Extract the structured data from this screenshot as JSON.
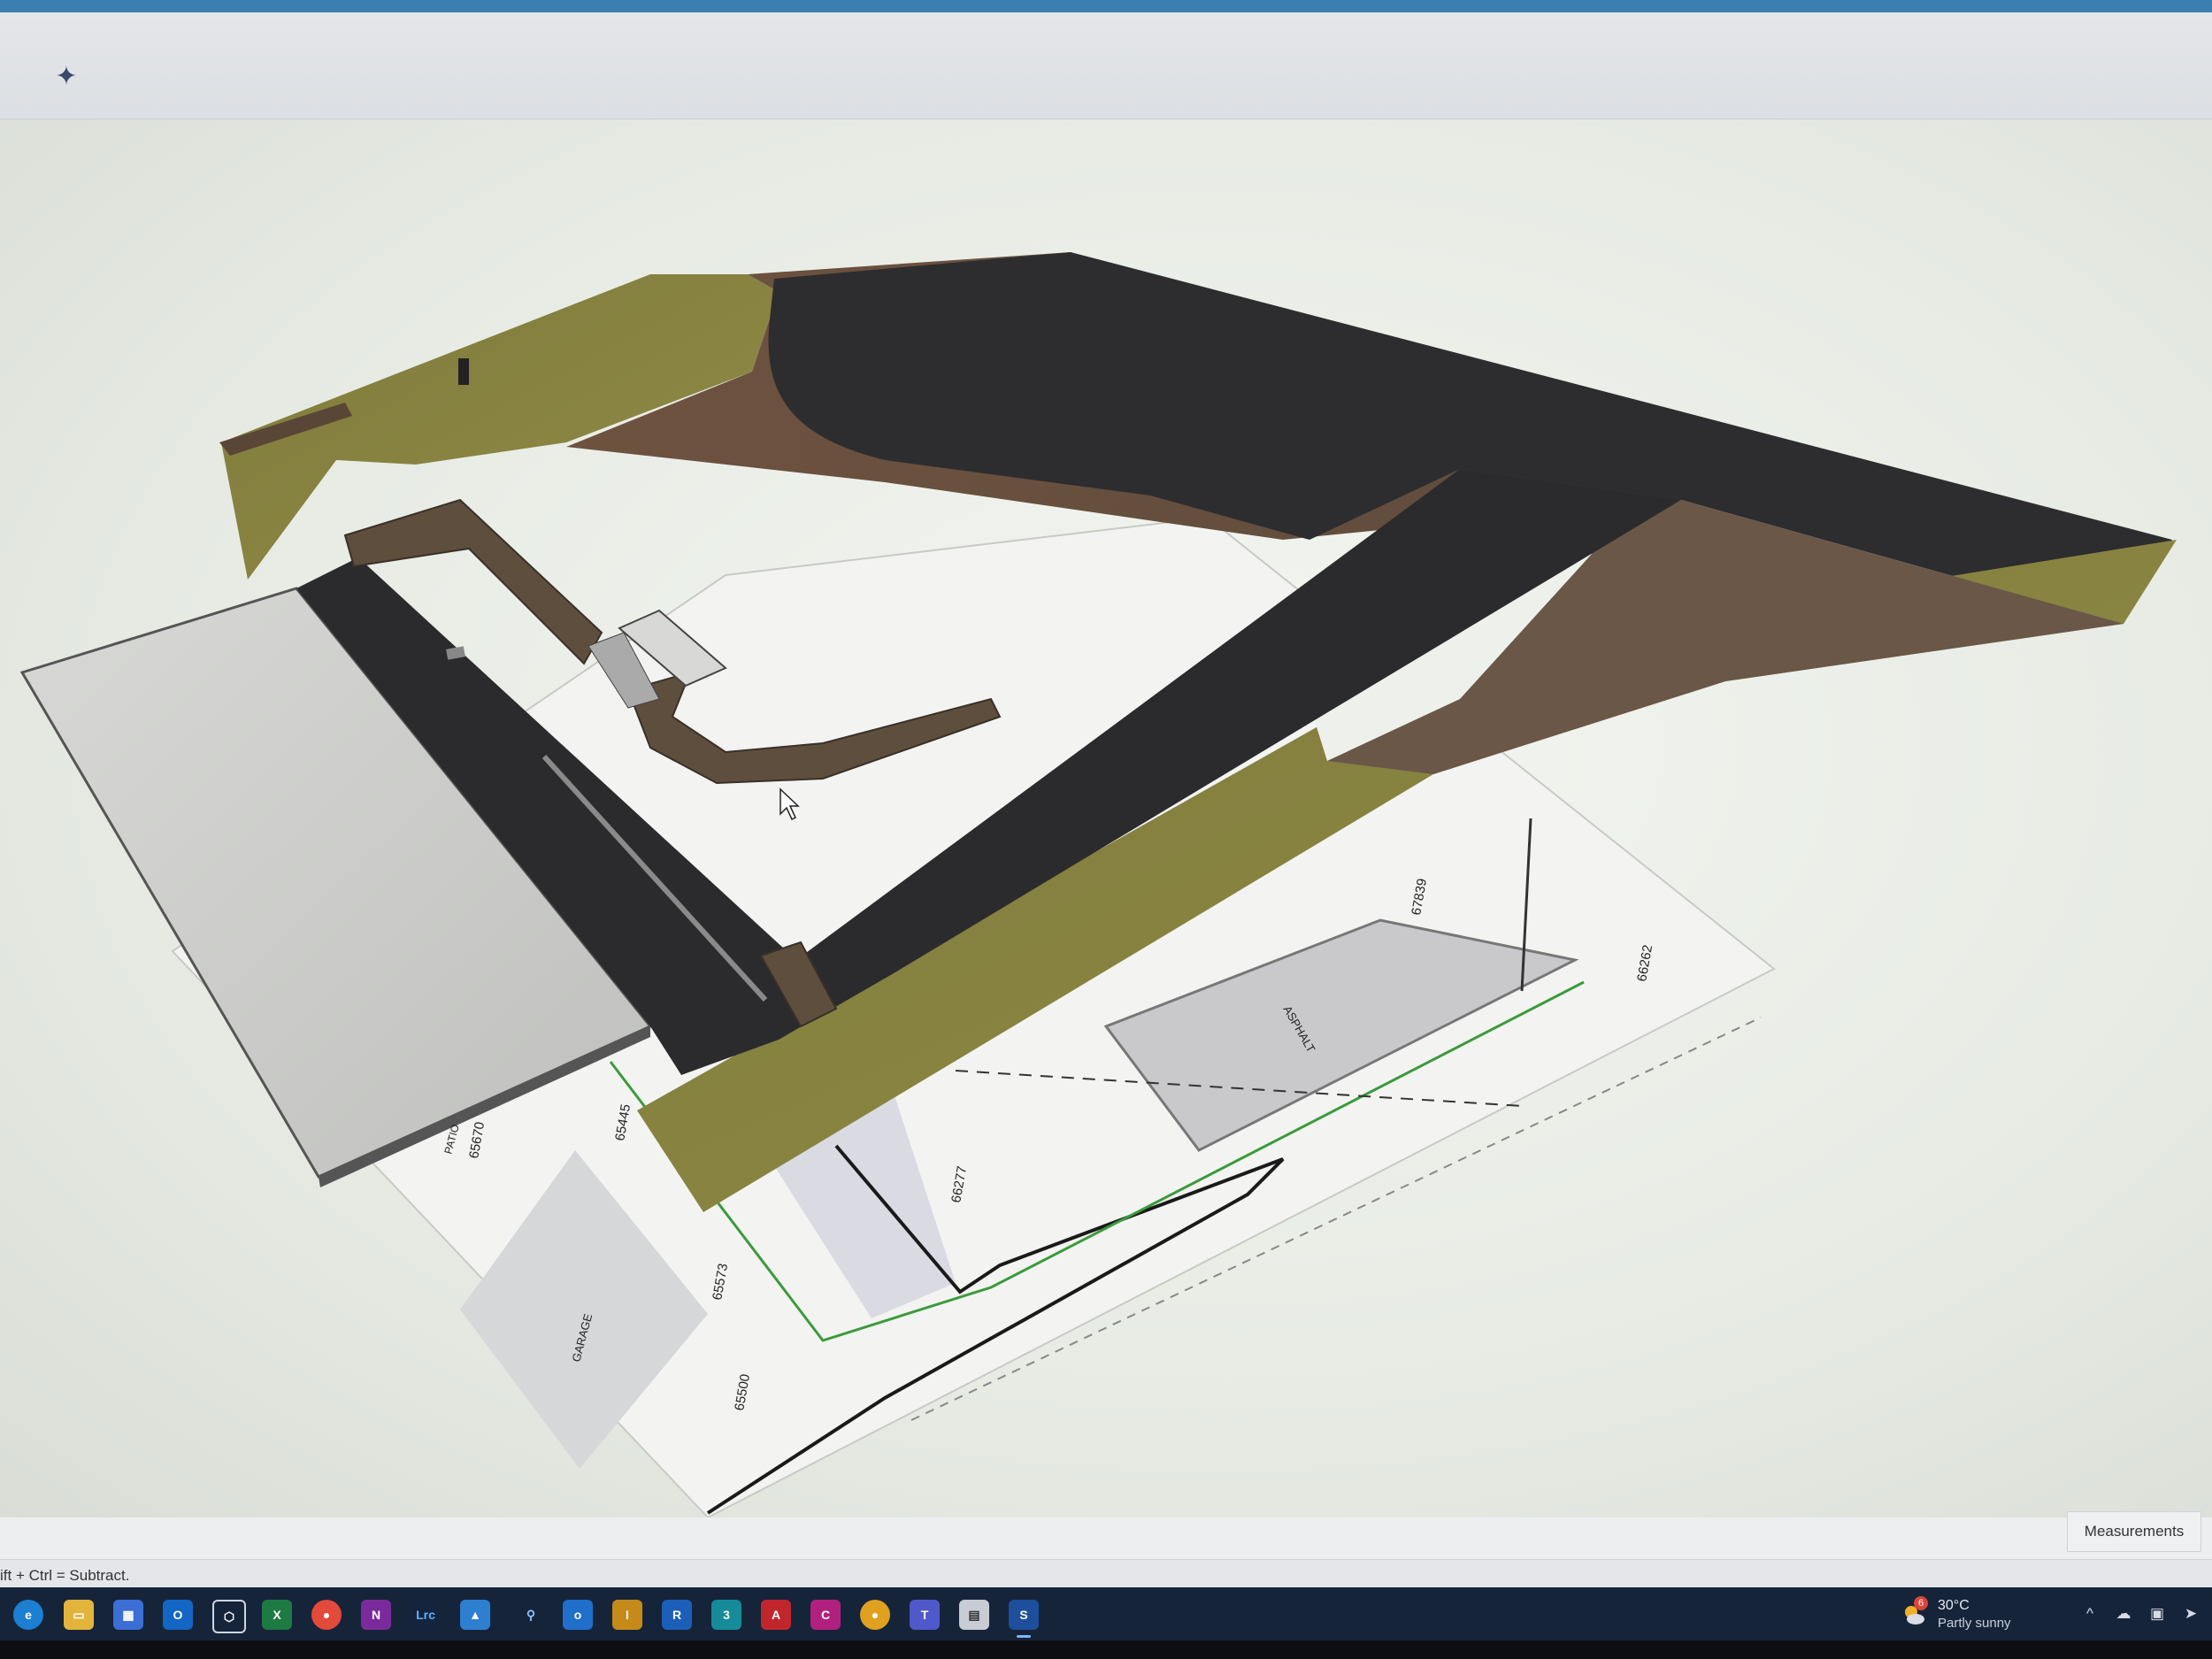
{
  "toolbar": {
    "ai_icon": "sparkle-icon"
  },
  "drawing_labels": {
    "elev_1": "65670",
    "elev_2": "65445",
    "elev_3": "65573",
    "elev_4": "65500",
    "elev_5": "66277",
    "elev_6": "67839",
    "elev_7": "66262",
    "patio": "PATIO",
    "garage": "GARAGE",
    "asphalt": "ASPHALT"
  },
  "status": {
    "hint": "ift + Ctrl = Subtract."
  },
  "panel": {
    "measurements": "Measurements"
  },
  "taskbar": {
    "icons": [
      "edge-icon",
      "file-explorer-icon",
      "store-icon",
      "outlook-icon",
      "sketchup-icon",
      "excel-icon",
      "chrome-icon",
      "onenote-icon",
      "lightroom-icon",
      "photos-icon",
      "search-icon",
      "outlook-new-icon",
      "archicad-icon",
      "revit-icon",
      "3dsmax-icon",
      "autocad-icon",
      "civil3d-icon",
      "chrome-dev-icon",
      "teams-icon",
      "clipboard-icon",
      "sketchup-pro-icon"
    ],
    "lrc_label": "Lrc"
  },
  "weather": {
    "badge": "6",
    "temp": "30°C",
    "condition": "Partly sunny"
  },
  "colors": {
    "asphalt": "#2b2b2d",
    "grass": "#86823f",
    "soil": "#6a5040",
    "concrete": "#cfd0cd",
    "stone_wall": "#5e4e3e",
    "taskbar": "#16243a"
  }
}
